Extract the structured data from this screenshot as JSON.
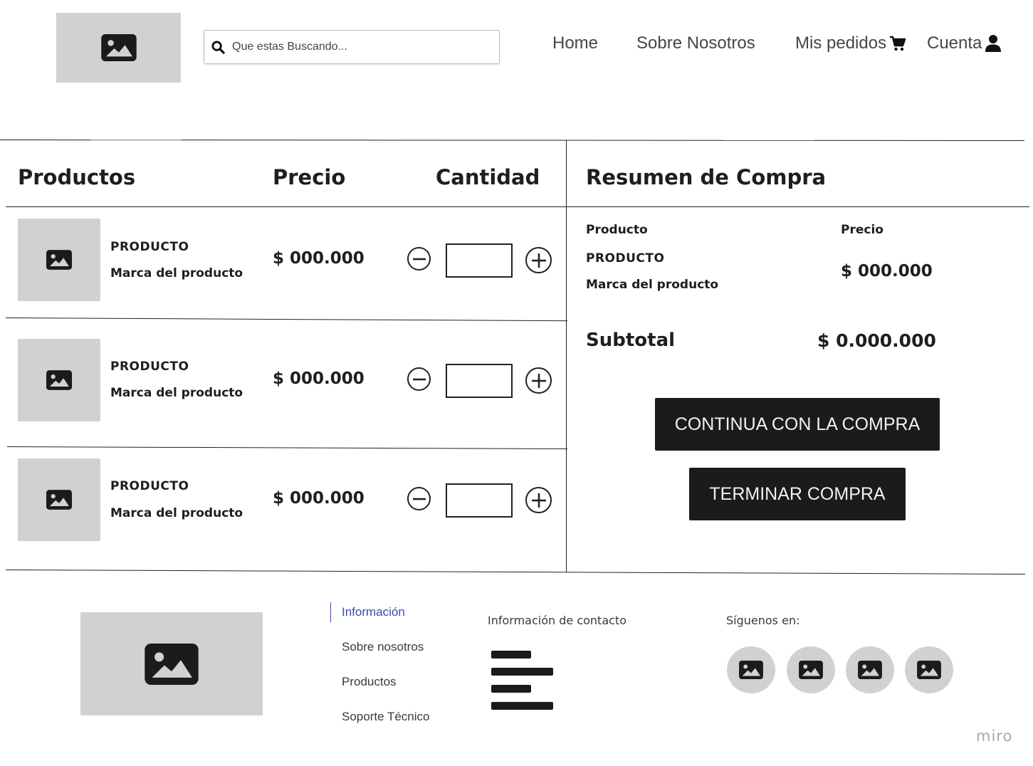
{
  "header": {
    "search_placeholder": "Que estas Buscando...",
    "nav": {
      "home": "Home",
      "about": "Sobre Nosotros",
      "orders": "Mis pedidos",
      "account": "Cuenta"
    }
  },
  "cart": {
    "columns": {
      "products": "Productos",
      "price": "Precio",
      "quantity": "Cantidad"
    },
    "items": [
      {
        "name": "PRODUCTO",
        "brand": "Marca del producto",
        "price": "$ 000.000",
        "quantity": ""
      },
      {
        "name": "PRODUCTO",
        "brand": "Marca del producto",
        "price": "$ 000.000",
        "quantity": ""
      },
      {
        "name": "PRODUCTO",
        "brand": "Marca del producto",
        "price": "$ 000.000",
        "quantity": ""
      }
    ]
  },
  "summary": {
    "title": "Resumen de Compra",
    "col_product": "Producto",
    "col_price": "Precio",
    "item": {
      "name": "PRODUCTO",
      "brand": "Marca del producto",
      "price": "$ 000.000"
    },
    "subtotal_label": "Subtotal",
    "subtotal_value": "$ 0.000.000",
    "continue_button": "CONTINUA CON LA COMPRA",
    "finish_button": "TERMINAR COMPRA"
  },
  "footer": {
    "links": [
      "Información",
      "Sobre nosotros",
      "Productos",
      "Soporte Técnico"
    ],
    "active_link_color": "#3b4ba8",
    "contact_title": "Información de contacto",
    "follow_title": "Síguenos en:",
    "social_icons": [
      "image-icon",
      "image-icon",
      "image-icon",
      "image-icon"
    ]
  },
  "watermark": "miro"
}
